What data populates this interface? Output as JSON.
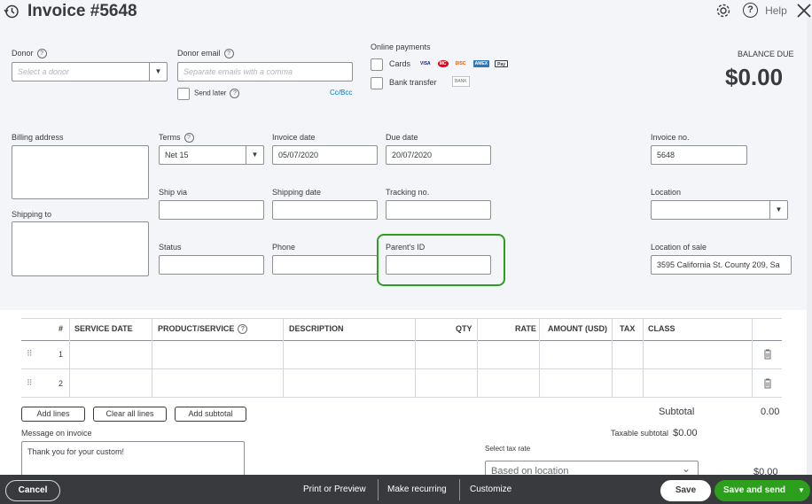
{
  "header": {
    "title": "Invoice #5648",
    "help_label": "Help"
  },
  "form": {
    "donor_label": "Donor",
    "donor_placeholder": "Select a donor",
    "donor_email_label": "Donor email",
    "donor_email_placeholder": "Separate emails with a comma",
    "send_later_label": "Send later",
    "cc_bcc_label": "Cc/Bcc",
    "online_payments_label": "Online payments",
    "cards_label": "Cards",
    "card_brands": [
      "VISA",
      "MC",
      "DISC",
      "AMEX",
      "Pay"
    ],
    "bank_transfer_label": "Bank transfer",
    "bank_badge": "BANK",
    "balance_due_label": "BALANCE DUE",
    "balance_due_value": "$0.00",
    "billing_address_label": "Billing address",
    "shipping_to_label": "Shipping to",
    "terms_label": "Terms",
    "terms_value": "Net 15",
    "invoice_date_label": "Invoice date",
    "invoice_date_value": "05/07/2020",
    "due_date_label": "Due date",
    "due_date_value": "20/07/2020",
    "invoice_no_label": "Invoice no.",
    "invoice_no_value": "5648",
    "ship_via_label": "Ship via",
    "shipping_date_label": "Shipping date",
    "tracking_no_label": "Tracking no.",
    "location_label": "Location",
    "status_label": "Status",
    "phone_label": "Phone",
    "parents_id_label": "Parent's ID",
    "location_of_sale_label": "Location of sale",
    "location_of_sale_value": "3595 California St. County 209, Sa",
    "highlight_color": "#2ca01c"
  },
  "table": {
    "headers": {
      "num": "#",
      "service_date": "SERVICE DATE",
      "product_service": "PRODUCT/SERVICE",
      "description": "DESCRIPTION",
      "qty": "QTY",
      "rate": "RATE",
      "amount": "AMOUNT (USD)",
      "tax": "TAX",
      "class": "CLASS"
    },
    "rows": [
      {
        "num": "1"
      },
      {
        "num": "2"
      }
    ]
  },
  "actions": {
    "add_lines": "Add lines",
    "clear_all_lines": "Clear all lines",
    "add_subtotal": "Add subtotal"
  },
  "totals": {
    "subtotal_label": "Subtotal",
    "subtotal_value": "0.00",
    "taxable_subtotal_label": "Taxable subtotal",
    "taxable_subtotal_value": "$0.00",
    "select_tax_rate_label": "Select tax rate",
    "tax_rate_value": "Based on location",
    "tax_value": "$0.00"
  },
  "message": {
    "label": "Message on invoice",
    "value": "Thank you for your custom!"
  },
  "footer": {
    "cancel": "Cancel",
    "print_preview": "Print or Preview",
    "make_recurring": "Make recurring",
    "customize": "Customize",
    "save": "Save",
    "save_and_send": "Save and send"
  }
}
